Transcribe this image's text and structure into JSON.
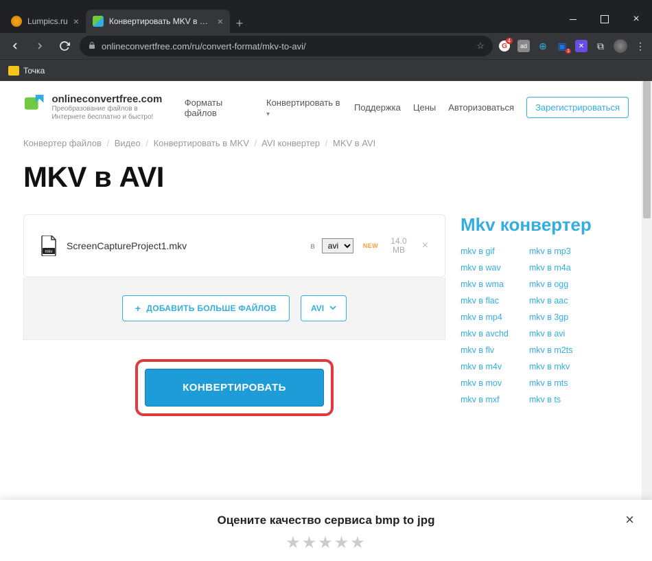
{
  "browser": {
    "tabs": [
      {
        "label": "Lumpics.ru",
        "active": false
      },
      {
        "label": "Конвертировать MKV в AVI онл",
        "active": true
      }
    ],
    "url": "onlineconvertfree.com/ru/convert-format/mkv-to-avi/",
    "bookmark_folder": "Точка"
  },
  "header": {
    "brand": "onlineconvertfree.com",
    "tagline": "Преобразование файлов в Интернете бесплатно и быстро!",
    "nav": {
      "formats": "Форматы файлов",
      "convert": "Конвертировать в",
      "support": "Поддержка",
      "prices": "Цены",
      "login": "Авторизоваться",
      "register": "Зарегистрироваться"
    }
  },
  "breadcrumbs": {
    "items": [
      "Конвертер файлов",
      "Видео",
      "Конвертировать в MKV",
      "AVI конвертер",
      "MKV в AVI"
    ],
    "sep": "/"
  },
  "title": "MKV в AVI",
  "file": {
    "name": "ScreenCaptureProject1.mkv",
    "to_label": "в",
    "format_selected": "avi",
    "new_badge": "NEW",
    "size_value": "14.0",
    "size_unit": "MB"
  },
  "actions": {
    "add_more": "ДОБАВИТЬ БОЛЬШЕ ФАЙЛОВ",
    "format_btn": "AVI",
    "convert": "КОНВЕРТИРОВАТЬ"
  },
  "sidebar": {
    "title": "Mkv конвертер",
    "col1": [
      "mkv в gif",
      "mkv в wav",
      "mkv в wma",
      "mkv в flac",
      "mkv в mp4",
      "mkv в avchd",
      "mkv в flv",
      "mkv в m4v",
      "mkv в mov",
      "mkv в mxf"
    ],
    "col2": [
      "mkv в mp3",
      "mkv в m4a",
      "mkv в ogg",
      "mkv в aac",
      "mkv в 3gp",
      "mkv в avi",
      "mkv в m2ts",
      "mkv в mkv",
      "mkv в mts",
      "mkv в ts"
    ]
  },
  "rating": {
    "title": "Оцените качество сервиса bmp to jpg"
  }
}
